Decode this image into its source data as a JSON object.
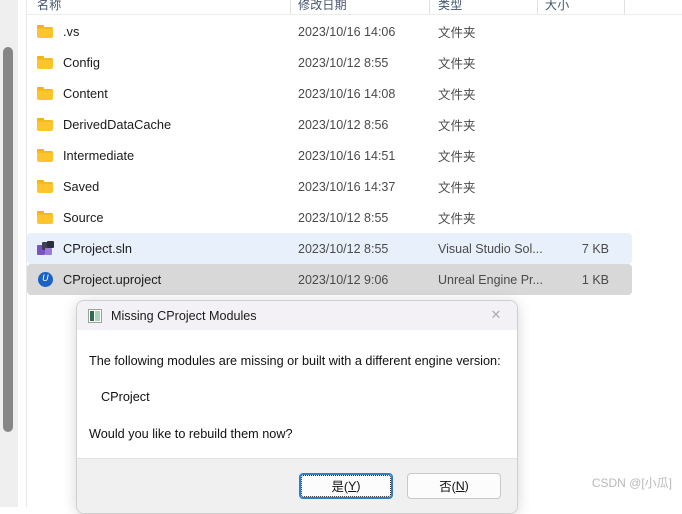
{
  "explorer": {
    "columns": [
      {
        "label": "名称",
        "key": "name"
      },
      {
        "label": "修改日期",
        "key": "date"
      },
      {
        "label": "类型",
        "key": "type"
      },
      {
        "label": "大小",
        "key": "size"
      }
    ],
    "rows": [
      {
        "icon": "folder-icon",
        "name": ".vs",
        "date": "2023/10/16 14:06",
        "type": "文件夹",
        "size": ""
      },
      {
        "icon": "folder-icon",
        "name": "Config",
        "date": "2023/10/12 8:55",
        "type": "文件夹",
        "size": ""
      },
      {
        "icon": "folder-icon",
        "name": "Content",
        "date": "2023/10/16 14:08",
        "type": "文件夹",
        "size": ""
      },
      {
        "icon": "folder-icon",
        "name": "DerivedDataCache",
        "date": "2023/10/12 8:56",
        "type": "文件夹",
        "size": ""
      },
      {
        "icon": "folder-icon",
        "name": "Intermediate",
        "date": "2023/10/16 14:51",
        "type": "文件夹",
        "size": ""
      },
      {
        "icon": "folder-icon",
        "name": "Saved",
        "date": "2023/10/16 14:37",
        "type": "文件夹",
        "size": ""
      },
      {
        "icon": "folder-icon",
        "name": "Source",
        "date": "2023/10/12 8:55",
        "type": "文件夹",
        "size": ""
      },
      {
        "icon": "visual-studio-solution-icon",
        "name": "CProject.sln",
        "date": "2023/10/12 8:55",
        "type": "Visual Studio Sol...",
        "size": "7 KB",
        "state": "hover"
      },
      {
        "icon": "unreal-engine-project-icon",
        "name": "CProject.uproject",
        "date": "2023/10/12 9:06",
        "type": "Unreal Engine Pr...",
        "size": "1 KB",
        "state": "selected"
      }
    ]
  },
  "dialog": {
    "icon": "unreal-engine-app-icon",
    "title": "Missing CProject Modules",
    "close_label": "✕",
    "message_line1": "The following modules are missing or built with a different engine version:",
    "module_name": "CProject",
    "message_line2": "Would you like to rebuild them now?",
    "buttons": [
      {
        "prefix": "是(",
        "accel": "Y",
        "suffix": ")",
        "name": "yes-button",
        "default": true
      },
      {
        "prefix": "否(",
        "accel": "N",
        "suffix": ")",
        "name": "no-button",
        "default": false
      }
    ]
  },
  "watermark": "CSDN @[小瓜]",
  "colors": {
    "folder": "#fcc52e",
    "accent": "#2f7ec4",
    "hover_row": "#e8f1fb",
    "selected_row": "#d8d8d8"
  }
}
